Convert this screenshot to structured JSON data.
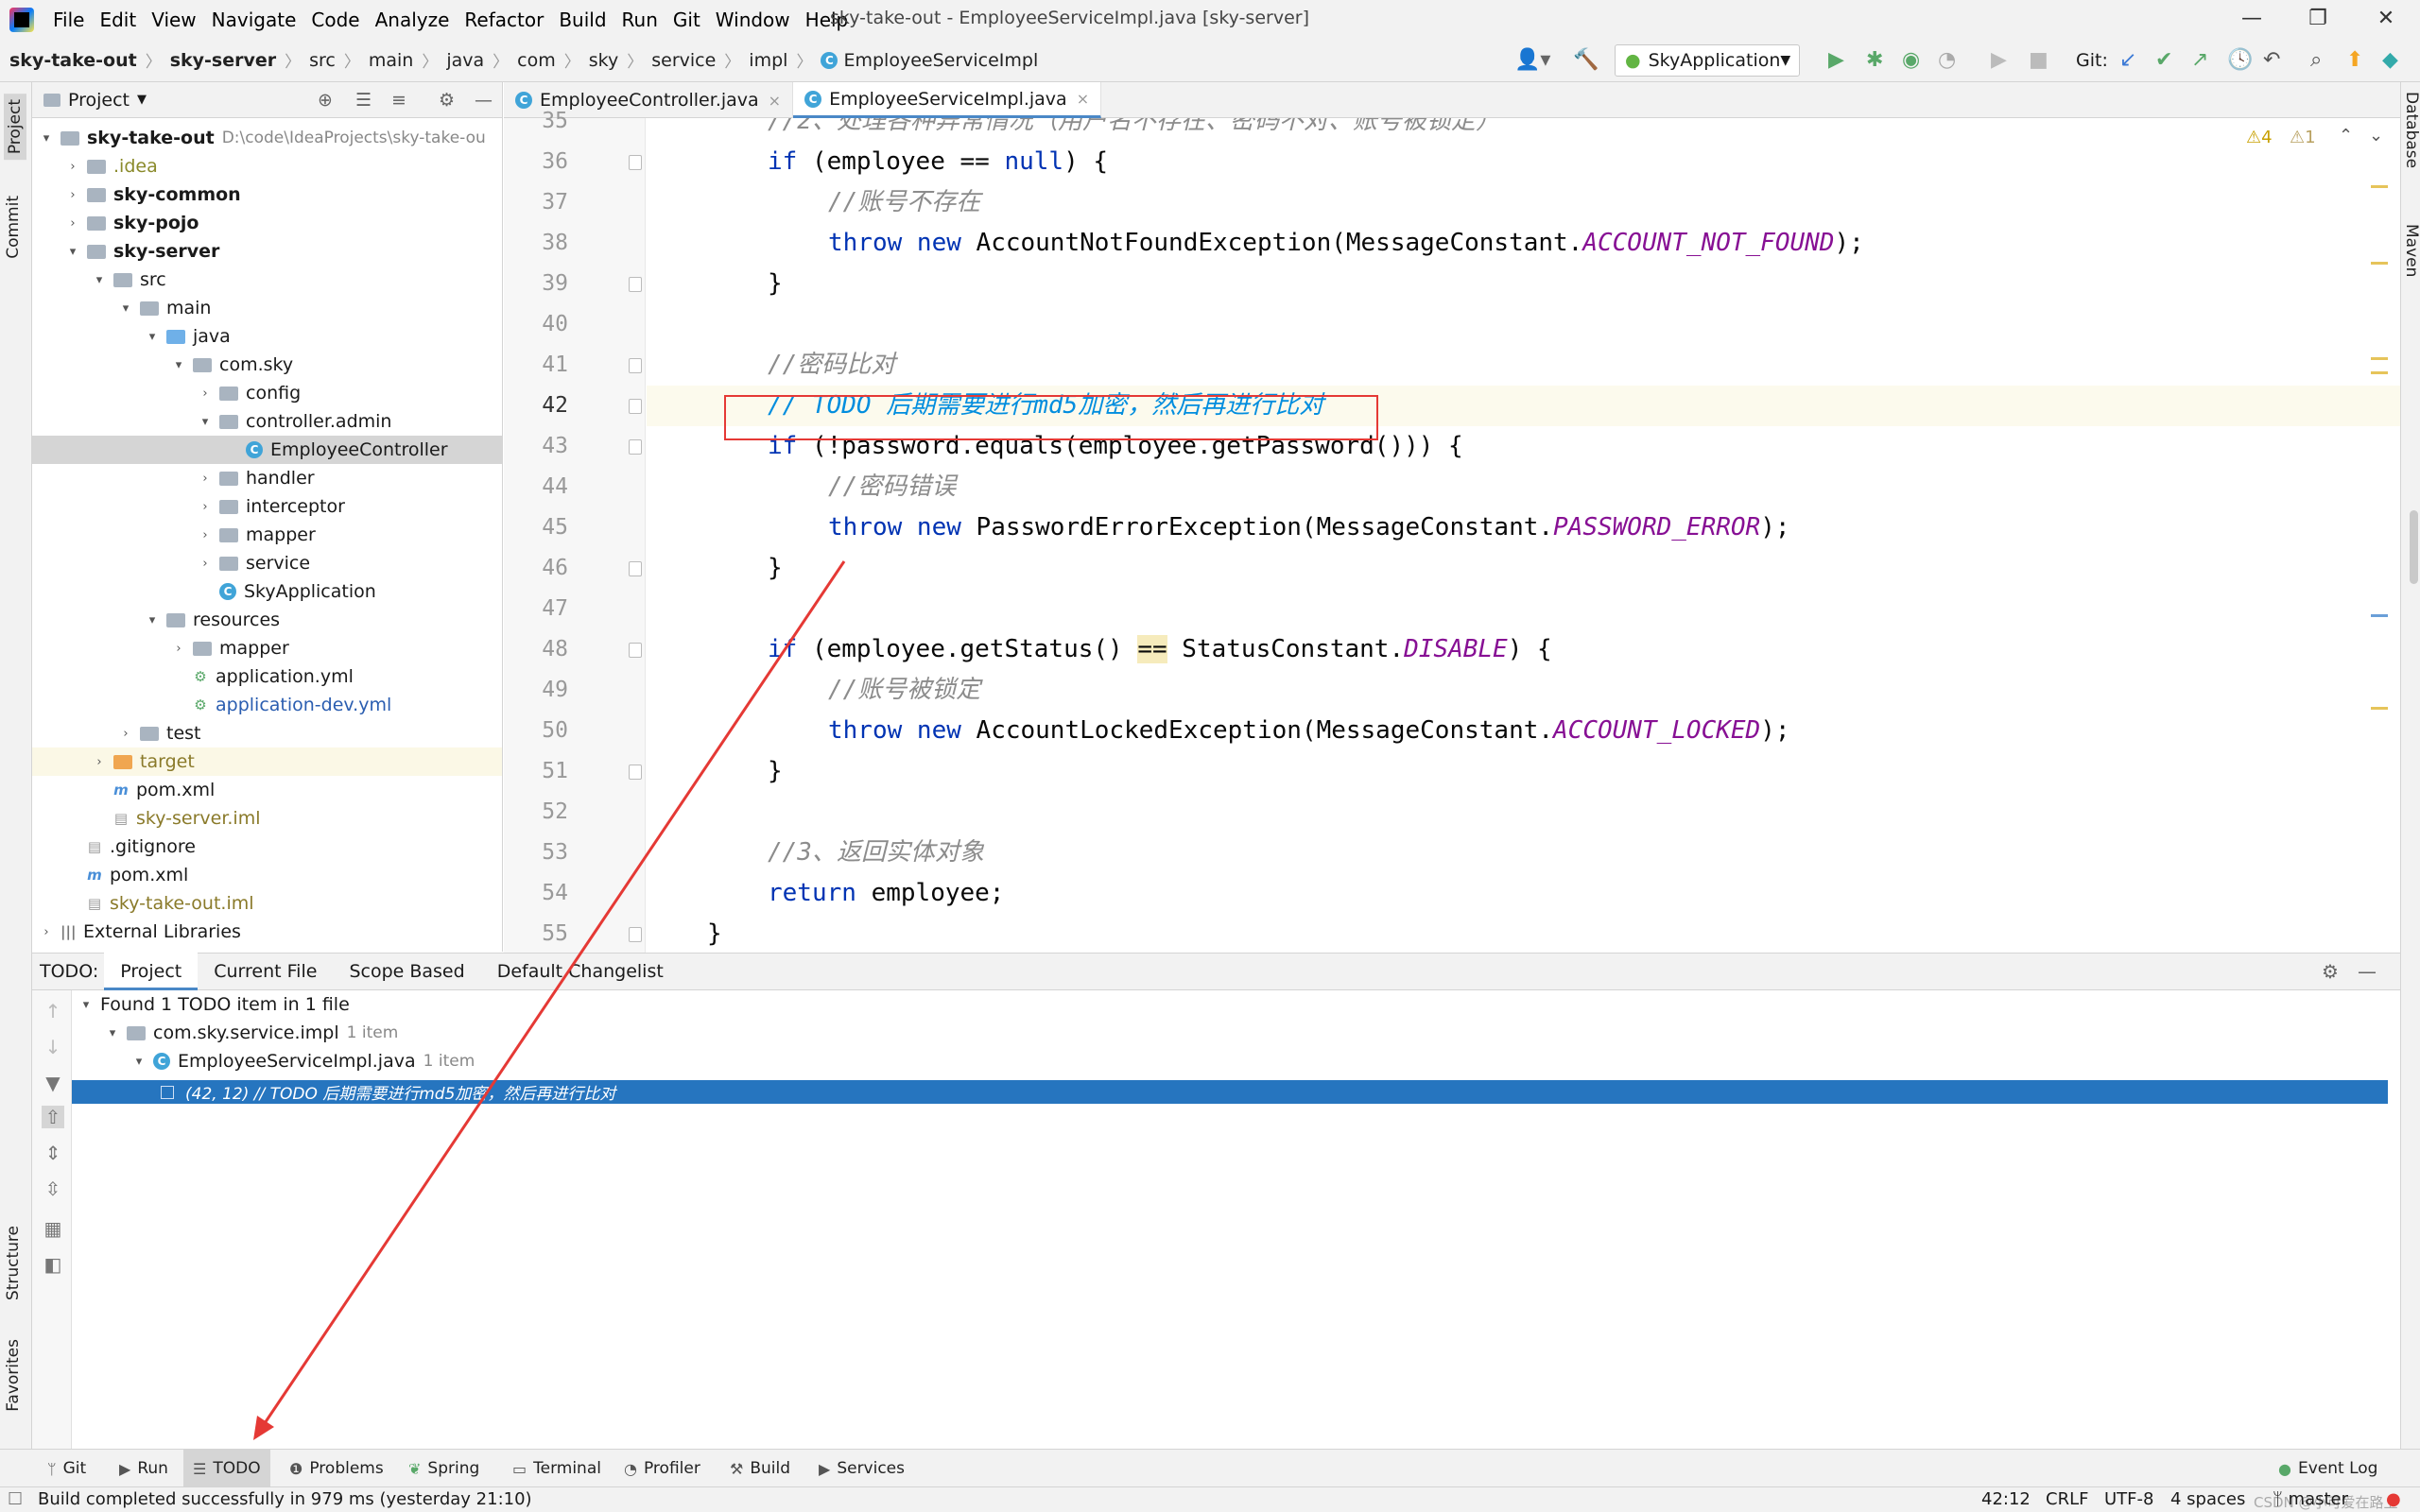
{
  "menubar": {
    "items": [
      "File",
      "Edit",
      "View",
      "Navigate",
      "Code",
      "Analyze",
      "Refactor",
      "Build",
      "Run",
      "Git",
      "Window",
      "Help"
    ],
    "window_title": "sky-take-out - EmployeeServiceImpl.java [sky-server]"
  },
  "navbar": {
    "breadcrumbs": [
      "sky-take-out",
      "sky-server",
      "src",
      "main",
      "java",
      "com",
      "sky",
      "service",
      "impl",
      "EmployeeServiceImpl"
    ],
    "run_config": "SkyApplication",
    "git_label": "Git:"
  },
  "side_tabs": {
    "project": "Project",
    "commit": "Commit",
    "structure": "Structure",
    "favorites": "Favorites",
    "database": "Database",
    "maven": "Maven"
  },
  "project": {
    "title": "Project",
    "tree": [
      {
        "label": "sky-take-out",
        "extra": "D:\\code\\IdeaProjects\\sky-take-ou",
        "bold": true
      },
      {
        "label": ".idea"
      },
      {
        "label": "sky-common",
        "bold": true
      },
      {
        "label": "sky-pojo",
        "bold": true
      },
      {
        "label": "sky-server",
        "bold": true
      },
      {
        "label": "src"
      },
      {
        "label": "main"
      },
      {
        "label": "java"
      },
      {
        "label": "com.sky"
      },
      {
        "label": "config"
      },
      {
        "label": "controller.admin"
      },
      {
        "label": "EmployeeController"
      },
      {
        "label": "handler"
      },
      {
        "label": "interceptor"
      },
      {
        "label": "mapper"
      },
      {
        "label": "service"
      },
      {
        "label": "SkyApplication"
      },
      {
        "label": "resources"
      },
      {
        "label": "mapper"
      },
      {
        "label": "application.yml"
      },
      {
        "label": "application-dev.yml"
      },
      {
        "label": "test"
      },
      {
        "label": "target"
      },
      {
        "label": "pom.xml"
      },
      {
        "label": "sky-server.iml"
      },
      {
        "label": ".gitignore"
      },
      {
        "label": "pom.xml"
      },
      {
        "label": "sky-take-out.iml"
      },
      {
        "label": "External Libraries"
      }
    ]
  },
  "editor": {
    "tabs": [
      "EmployeeController.java",
      "EmployeeServiceImpl.java"
    ],
    "inspection": {
      "warnings": "4",
      "weak_warnings": "1"
    },
    "line_numbers": [
      "35",
      "36",
      "37",
      "38",
      "39",
      "40",
      "41",
      "42",
      "43",
      "44",
      "45",
      "46",
      "47",
      "48",
      "49",
      "50",
      "51",
      "52",
      "53",
      "54",
      "55"
    ],
    "code": {
      "l35": "//2、处理各种异常情况（用户名不存在、密码不对、账号被锁定）",
      "l36a": "if",
      "l36b": " (employee == ",
      "l36c": "null",
      "l36d": ") {",
      "l37": "//账号不存在",
      "l38a": "throw new",
      "l38b": " AccountNotFoundException(MessageConstant.",
      "l38c": "ACCOUNT_NOT_FOUND",
      "l38d": ");",
      "l39": "}",
      "l41": "//密码比对",
      "l42a": "// ",
      "l42b": "TODO 后期需要进行md5加密，然后再进行比对",
      "l43a": "if",
      "l43b": " (!password.equals(employee.getPassword())) {",
      "l44": "//密码错误",
      "l45a": "throw new",
      "l45b": " PasswordErrorException(MessageConstant.",
      "l45c": "PASSWORD_ERROR",
      "l45d": ");",
      "l46": "}",
      "l48a": "if",
      "l48b": " (employee.getStatus() ",
      "l48c": "==",
      "l48d": " StatusConstant.",
      "l48e": "DISABLE",
      "l48f": ") {",
      "l49": "//账号被锁定",
      "l50a": "throw new",
      "l50b": " AccountLockedException(MessageConstant.",
      "l50c": "ACCOUNT_LOCKED",
      "l50d": ");",
      "l51": "}",
      "l53": "//3、返回实体对象",
      "l54a": "return",
      "l54b": " employee;",
      "l55": "}"
    }
  },
  "todo_panel": {
    "label": "TODO:",
    "tabs": [
      "Project",
      "Current File",
      "Scope Based",
      "Default Changelist"
    ],
    "summary": "Found 1 TODO item in 1 file",
    "package": "com.sky.service.impl",
    "package_count": "1 item",
    "file": "EmployeeServiceImpl.java",
    "file_count": "1 item",
    "entry": "(42, 12) // TODO 后期需要进行md5加密，然后再进行比对"
  },
  "bottom_tools": [
    "Git",
    "Run",
    "TODO",
    "Problems",
    "Spring",
    "Terminal",
    "Profiler",
    "Build",
    "Services",
    "Event Log"
  ],
  "status": {
    "message": "Build completed successfully in 979 ms (yesterday 21:10)",
    "position": "42:12",
    "line_sep": "CRLF",
    "encoding": "UTF-8",
    "indent": "4 spaces",
    "branch": "master",
    "watermark": "CSDN @小可爱在路上"
  },
  "colors": {
    "accent": "#2675bf",
    "annotation": "#e53935",
    "keyword": "#0033b3",
    "todo": "#008dde",
    "constant": "#871094"
  }
}
